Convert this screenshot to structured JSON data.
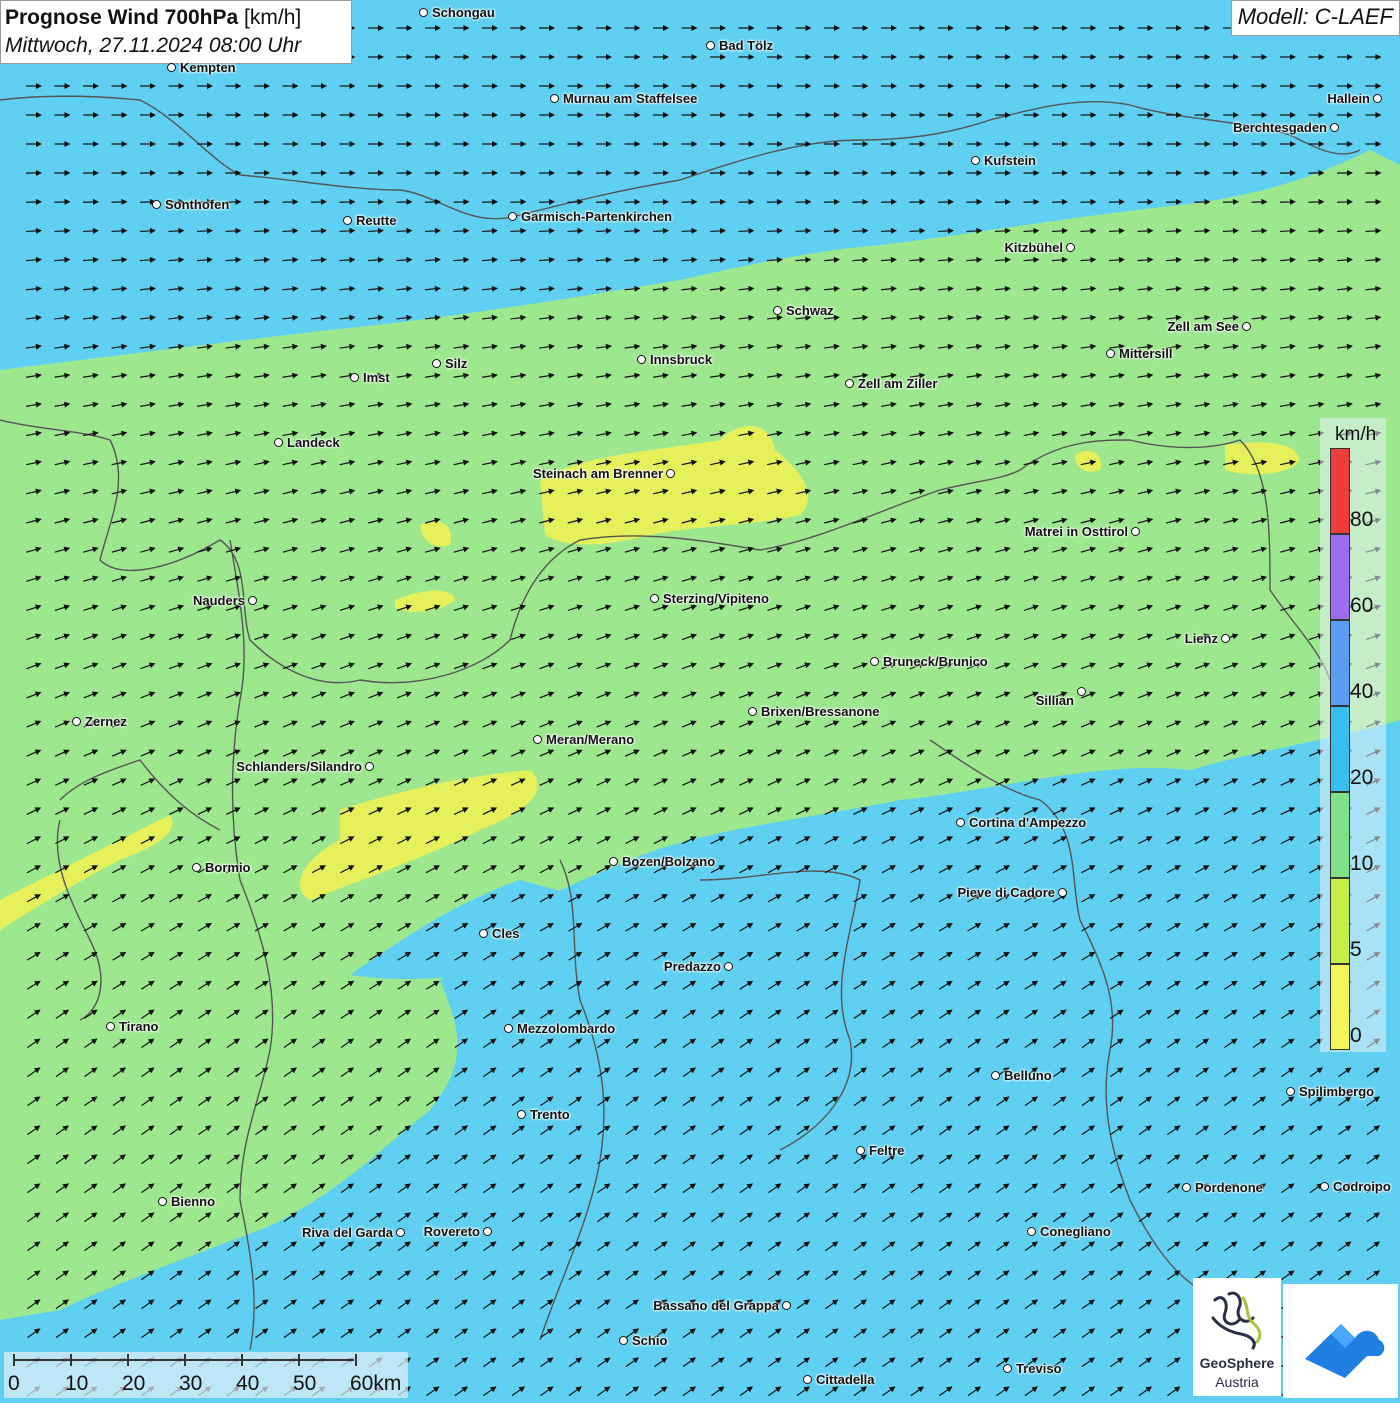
{
  "title": {
    "main": "Prognose Wind 700hPa",
    "unit": "[km/h]",
    "datetime": "Mittwoch, 27.11.2024 08:00 Uhr"
  },
  "model": "Modell: C-LAEF",
  "legend": {
    "unit": "km/h",
    "labels": [
      "80",
      "60",
      "40",
      "20",
      "10",
      "5",
      "0"
    ],
    "colors": [
      "#ee3b3b",
      "#9b6ef0",
      "#5b9bf0",
      "#37c0ef",
      "#7fe08a",
      "#c5ee4a",
      "#f5f55a"
    ]
  },
  "scale_bar": {
    "labels": [
      "0",
      "10",
      "20",
      "30",
      "40",
      "50",
      "60km"
    ]
  },
  "map_colors": {
    "wind_0_5": "#e6f05a",
    "wind_5_10": "#9de88f",
    "wind_10_20": "#5fd0f2",
    "border": "#555555"
  },
  "cities": [
    {
      "name": "Schongau"
    },
    {
      "name": "Bad Tölz"
    },
    {
      "name": "Kempten"
    },
    {
      "name": "Murnau am Staffelsee"
    },
    {
      "name": "Hallein"
    },
    {
      "name": "Berchtesgaden"
    },
    {
      "name": "Kufstein"
    },
    {
      "name": "Sonthofen"
    },
    {
      "name": "Reutte"
    },
    {
      "name": "Garmisch-Partenkirchen"
    },
    {
      "name": "Kitzbühel"
    },
    {
      "name": "Schwaz"
    },
    {
      "name": "Zell am See"
    },
    {
      "name": "Mittersill"
    },
    {
      "name": "Innsbruck"
    },
    {
      "name": "Silz"
    },
    {
      "name": "Imst"
    },
    {
      "name": "Zell am Ziller"
    },
    {
      "name": "Landeck"
    },
    {
      "name": "Steinach am Brenner"
    },
    {
      "name": "Matrei in Osttirol"
    },
    {
      "name": "Nauders"
    },
    {
      "name": "Sterzing/Vipiteno"
    },
    {
      "name": "Lienz"
    },
    {
      "name": "Bruneck/Brunico"
    },
    {
      "name": "Sillian"
    },
    {
      "name": "Zernez"
    },
    {
      "name": "Brixen/Bressanone"
    },
    {
      "name": "Meran/Merano"
    },
    {
      "name": "Schlanders/Silandro"
    },
    {
      "name": "Cortina d'Ampezzo"
    },
    {
      "name": "Bozen/Bolzano"
    },
    {
      "name": "Bormio"
    },
    {
      "name": "Pieve di Cadore"
    },
    {
      "name": "Cles"
    },
    {
      "name": "Predazzo"
    },
    {
      "name": "Tirano"
    },
    {
      "name": "Mezzolombardo"
    },
    {
      "name": "Belluno"
    },
    {
      "name": "Spilimbergo"
    },
    {
      "name": "Trento"
    },
    {
      "name": "Feltre"
    },
    {
      "name": "Pordenone"
    },
    {
      "name": "Codroipo"
    },
    {
      "name": "Bienno"
    },
    {
      "name": "Riva del Garda"
    },
    {
      "name": "Rovereto"
    },
    {
      "name": "Conegliano"
    },
    {
      "name": "Bassano del Grappa"
    },
    {
      "name": "Schio"
    },
    {
      "name": "Treviso"
    },
    {
      "name": "Cittadella"
    }
  ],
  "logo": {
    "line1": "GeoSphere",
    "line2": "Austria"
  }
}
